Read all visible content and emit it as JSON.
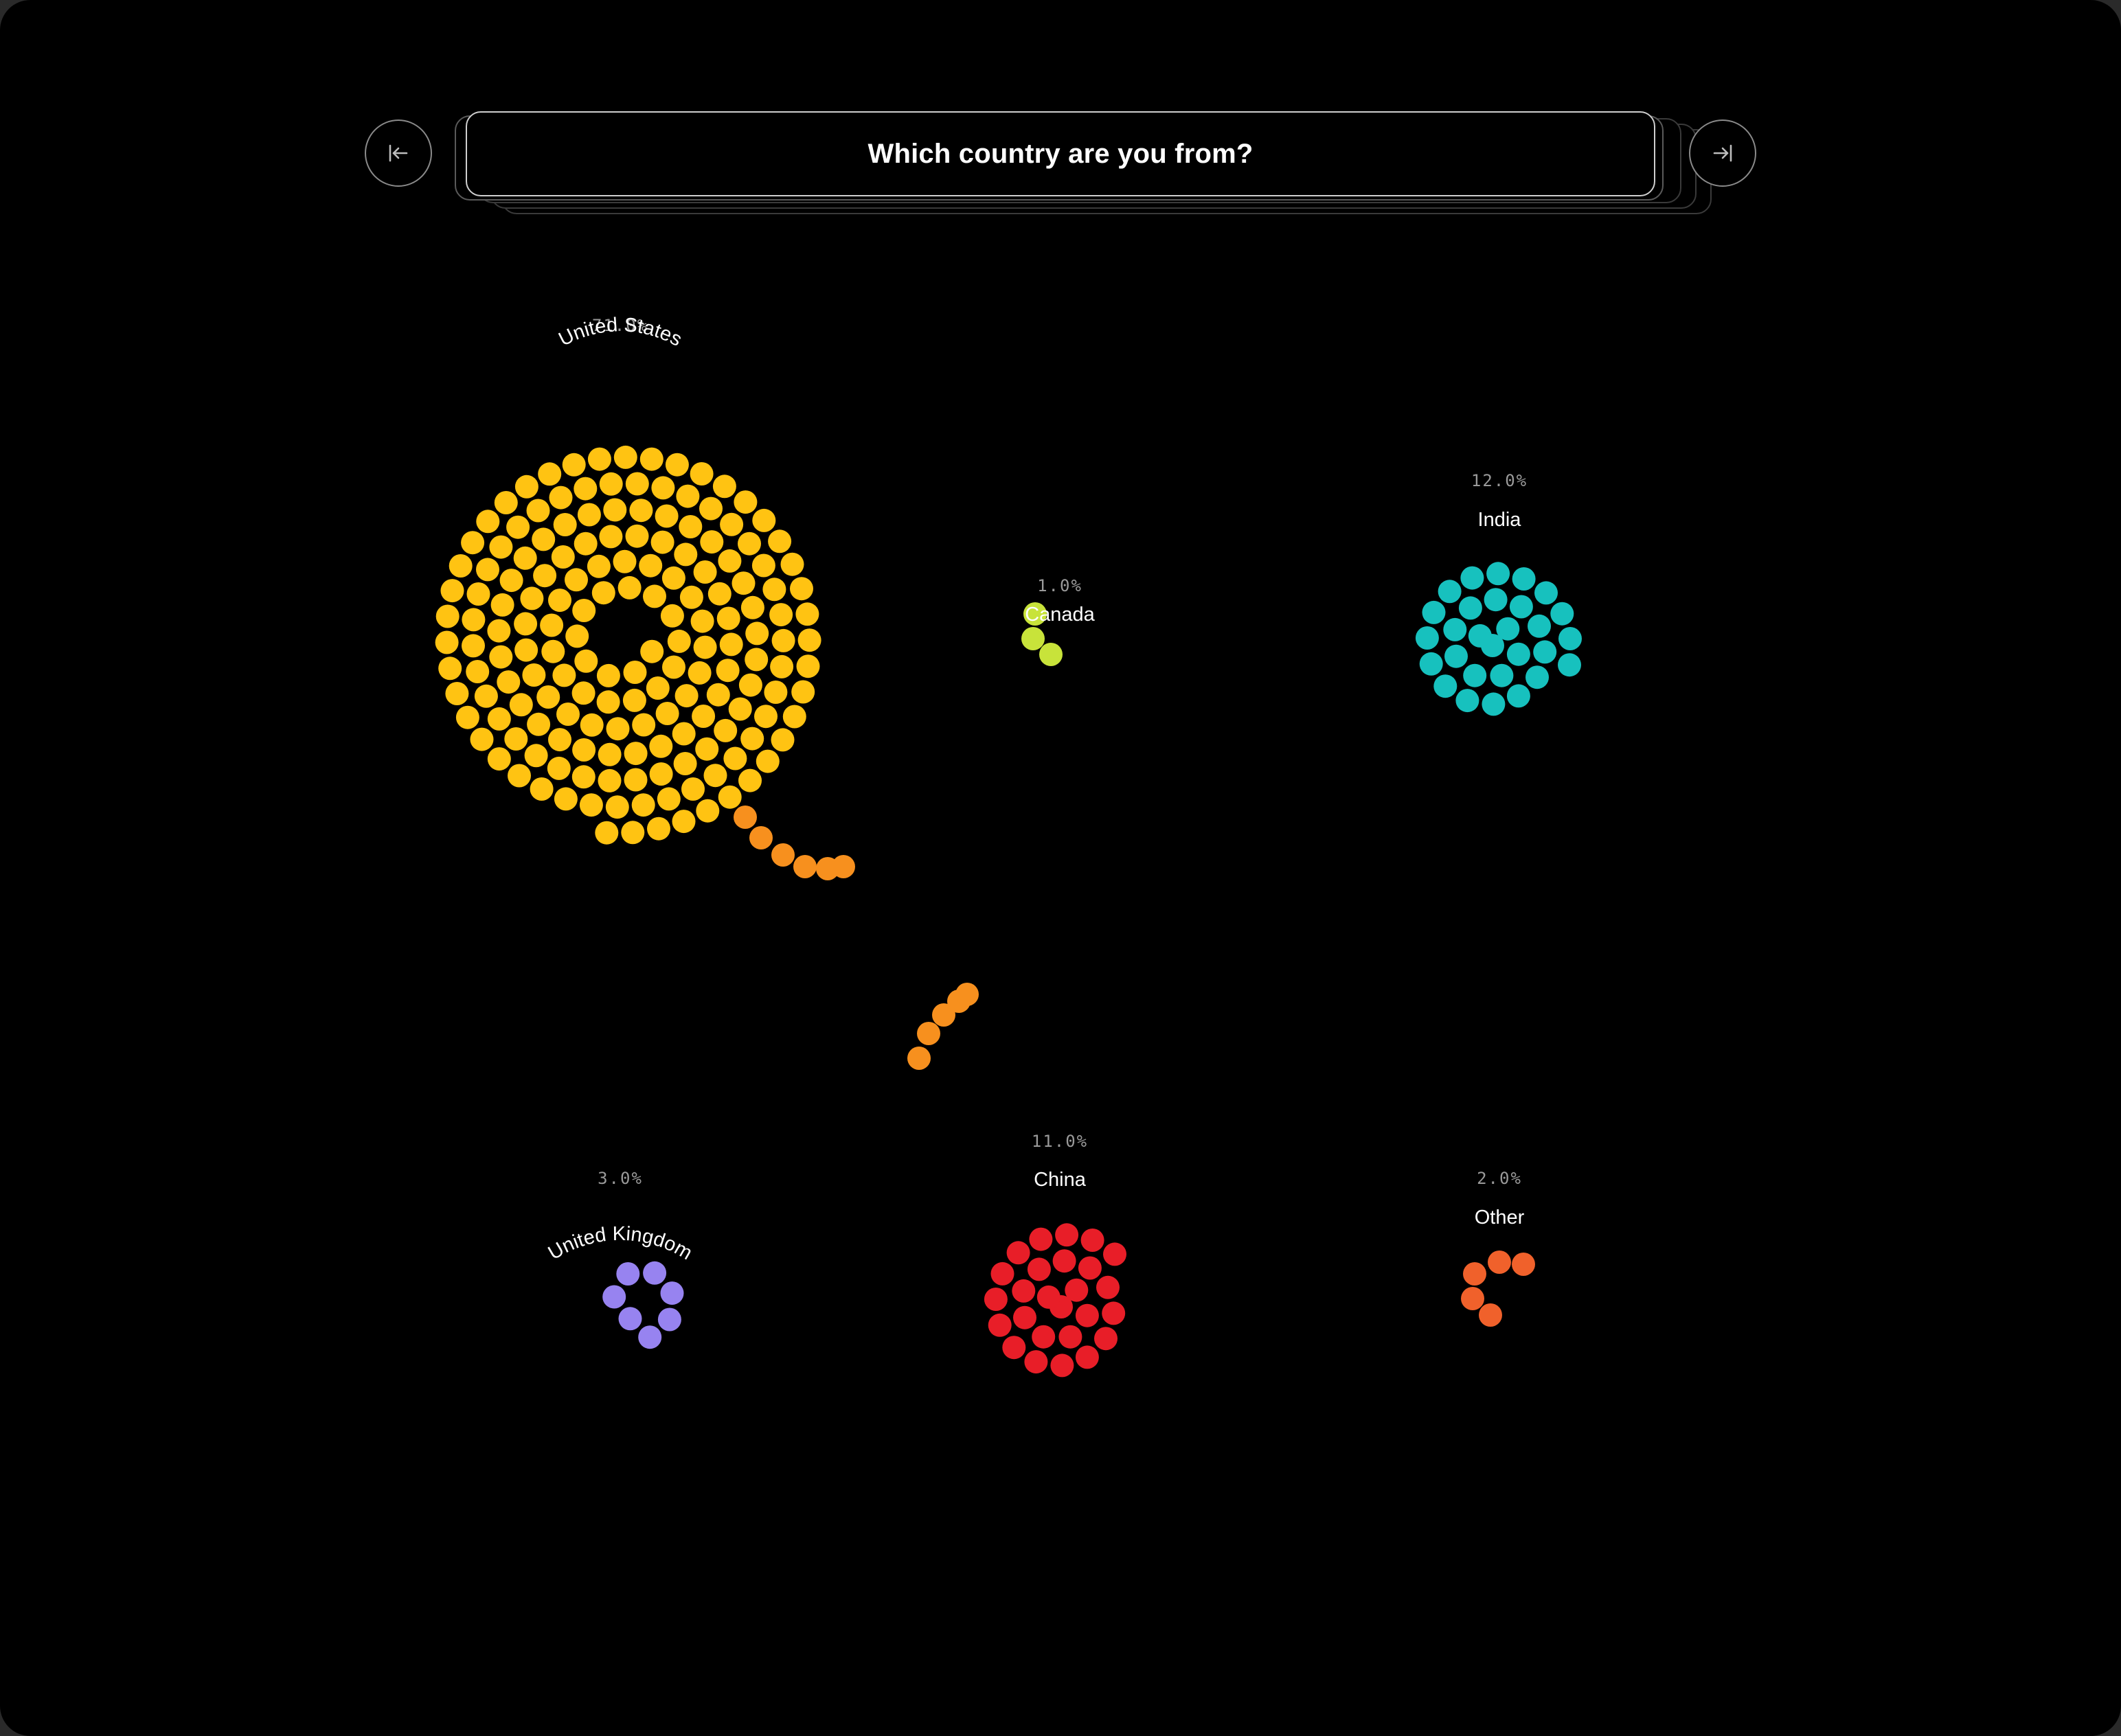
{
  "question": "Which country are you from?",
  "navigation": {
    "prev_icon": "arrow-left-to-line-icon",
    "next_icon": "arrow-right-to-line-icon"
  },
  "chart_data": {
    "type": "bubble-cluster",
    "title": "Which country are you from?",
    "series": [
      {
        "name": "United States",
        "value": 71.0,
        "label": "71.0%",
        "color": "#FFC312"
      },
      {
        "name": "India",
        "value": 12.0,
        "label": "12.0%",
        "color": "#17C1BE"
      },
      {
        "name": "China",
        "value": 11.0,
        "label": "11.0%",
        "color": "#E81E28"
      },
      {
        "name": "United Kingdom",
        "value": 3.0,
        "label": "3.0%",
        "color": "#9783F0"
      },
      {
        "name": "Other",
        "value": 2.0,
        "label": "2.0%",
        "color": "#F0612B"
      },
      {
        "name": "Canada",
        "value": 1.0,
        "label": "1.0%",
        "color": "#C8E33A"
      }
    ],
    "transition_color": "#F7901E"
  }
}
